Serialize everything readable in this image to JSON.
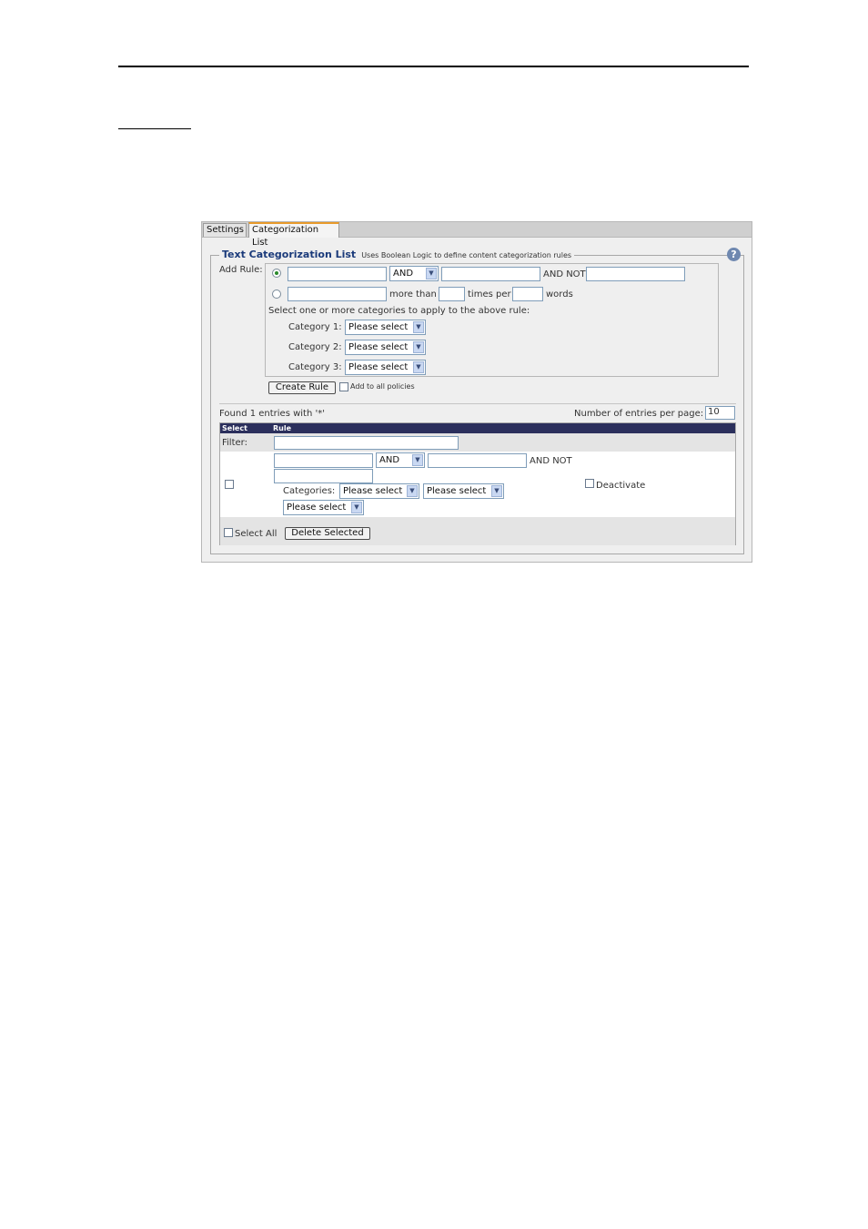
{
  "tabs": [
    {
      "label": "Settings"
    },
    {
      "label": "Categorization List"
    }
  ],
  "legend": {
    "title": "Text Categorization List",
    "subtitle": "Uses Boolean Logic to define content categorization rules",
    "help": "?"
  },
  "add_rule": {
    "label": "Add Rule:",
    "operator": "AND",
    "and_not": "AND NOT",
    "more_than": "more than",
    "times_per": "times per",
    "words": "words",
    "select_text": "Select one or more categories to apply to the above rule:",
    "categories": [
      {
        "label": "Category 1:",
        "value": "Please select"
      },
      {
        "label": "Category 2:",
        "value": "Please select"
      },
      {
        "label": "Category 3:",
        "value": "Please select"
      }
    ]
  },
  "create_rule_button": "Create Rule",
  "add_to_all_policies": "Add to all policies",
  "results": {
    "found_text": "Found 1 entries with '*'",
    "per_page_label": "Number of entries per page:",
    "per_page_value": "10",
    "col_select": "Select",
    "col_rule": "Rule",
    "filter_label": "Filter:"
  },
  "entry": {
    "operator": "AND",
    "and_not": "AND NOT",
    "categories_label": "Categories:",
    "category_values": [
      "Please select",
      "Please select",
      "Please select"
    ],
    "deactivate": "Deactivate"
  },
  "footer": {
    "select_all": "Select All",
    "delete_selected": "Delete Selected"
  }
}
